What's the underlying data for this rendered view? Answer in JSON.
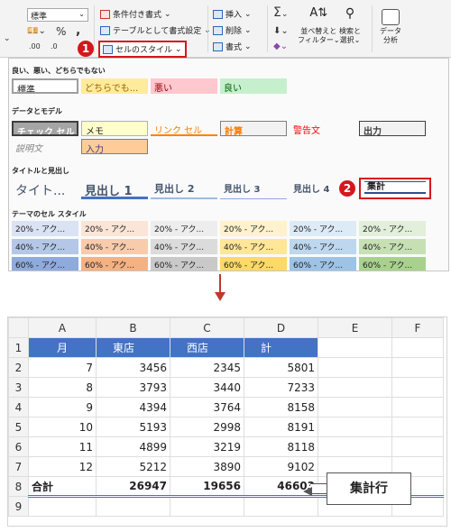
{
  "ribbon": {
    "number_format_value": "標準",
    "currency_icon": "currency-icon",
    "percent_label": "%",
    "comma_label": ",",
    "decimal_inc_label": ".00",
    "decimal_dec_label": ".0",
    "conditional_format": "条件付き書式",
    "format_as_table": "テーブルとして書式設定",
    "cell_styles": "セルのスタイル",
    "insert": "挿入",
    "delete": "削除",
    "format": "書式",
    "sigma": "Σ",
    "sort_filter_line1": "並べ替えと",
    "sort_filter_line2": "フィルター",
    "find_select_line1": "検索と",
    "find_select_line2": "選択",
    "analyze_line1": "データ",
    "analyze_line2": "分析",
    "marker1": "1",
    "marker2": "2"
  },
  "gallery": {
    "sections": {
      "good_bad": "良い、悪い、どちらでもない",
      "data_model": "データとモデル",
      "titles": "タイトルと見出し",
      "theme": "テーマのセル スタイル"
    },
    "good_bad": [
      "標準",
      "どちらでも...",
      "悪い",
      "良い"
    ],
    "data_model_row1": [
      "チェック セル",
      "メモ",
      "リンク セル",
      "計算",
      "警告文",
      "出力"
    ],
    "data_model_row2": [
      "説明文",
      "入力"
    ],
    "titles": [
      "タイト...",
      "見出し 1",
      "見出し 2",
      "見出し 3",
      "見出し 4",
      "集計"
    ],
    "theme_rows": [
      [
        "20% - アク...",
        "20% - アク...",
        "20% - アク...",
        "20% - アク...",
        "20% - アク...",
        "20% - アク..."
      ],
      [
        "40% - アク...",
        "40% - アク...",
        "40% - アク...",
        "40% - アク...",
        "40% - アク...",
        "40% - アク..."
      ],
      [
        "60% - アク...",
        "60% - アク...",
        "60% - アク...",
        "60% - アク...",
        "60% - アク...",
        "60% - アク..."
      ]
    ],
    "colors": {
      "accent": [
        "#4472c4",
        "#ed7d31",
        "#a5a5a5",
        "#ffc000",
        "#5b9bd5",
        "#70ad47"
      ]
    }
  },
  "sheet": {
    "columns": [
      "A",
      "B",
      "C",
      "D",
      "E",
      "F"
    ],
    "rows": [
      {
        "n": "1",
        "cells": [
          "月",
          "東店",
          "西店",
          "計"
        ]
      },
      {
        "n": "2",
        "cells": [
          "7",
          "3456",
          "2345",
          "5801"
        ]
      },
      {
        "n": "3",
        "cells": [
          "8",
          "3793",
          "3440",
          "7233"
        ]
      },
      {
        "n": "4",
        "cells": [
          "9",
          "4394",
          "3764",
          "8158"
        ]
      },
      {
        "n": "5",
        "cells": [
          "10",
          "5193",
          "2998",
          "8191"
        ]
      },
      {
        "n": "6",
        "cells": [
          "11",
          "4899",
          "3219",
          "8118"
        ]
      },
      {
        "n": "7",
        "cells": [
          "12",
          "5212",
          "3890",
          "9102"
        ]
      },
      {
        "n": "8",
        "cells": [
          "合計",
          "26947",
          "19656",
          "46603"
        ]
      },
      {
        "n": "9",
        "cells": [
          "",
          "",
          "",
          ""
        ]
      }
    ]
  },
  "callout": "集計行"
}
